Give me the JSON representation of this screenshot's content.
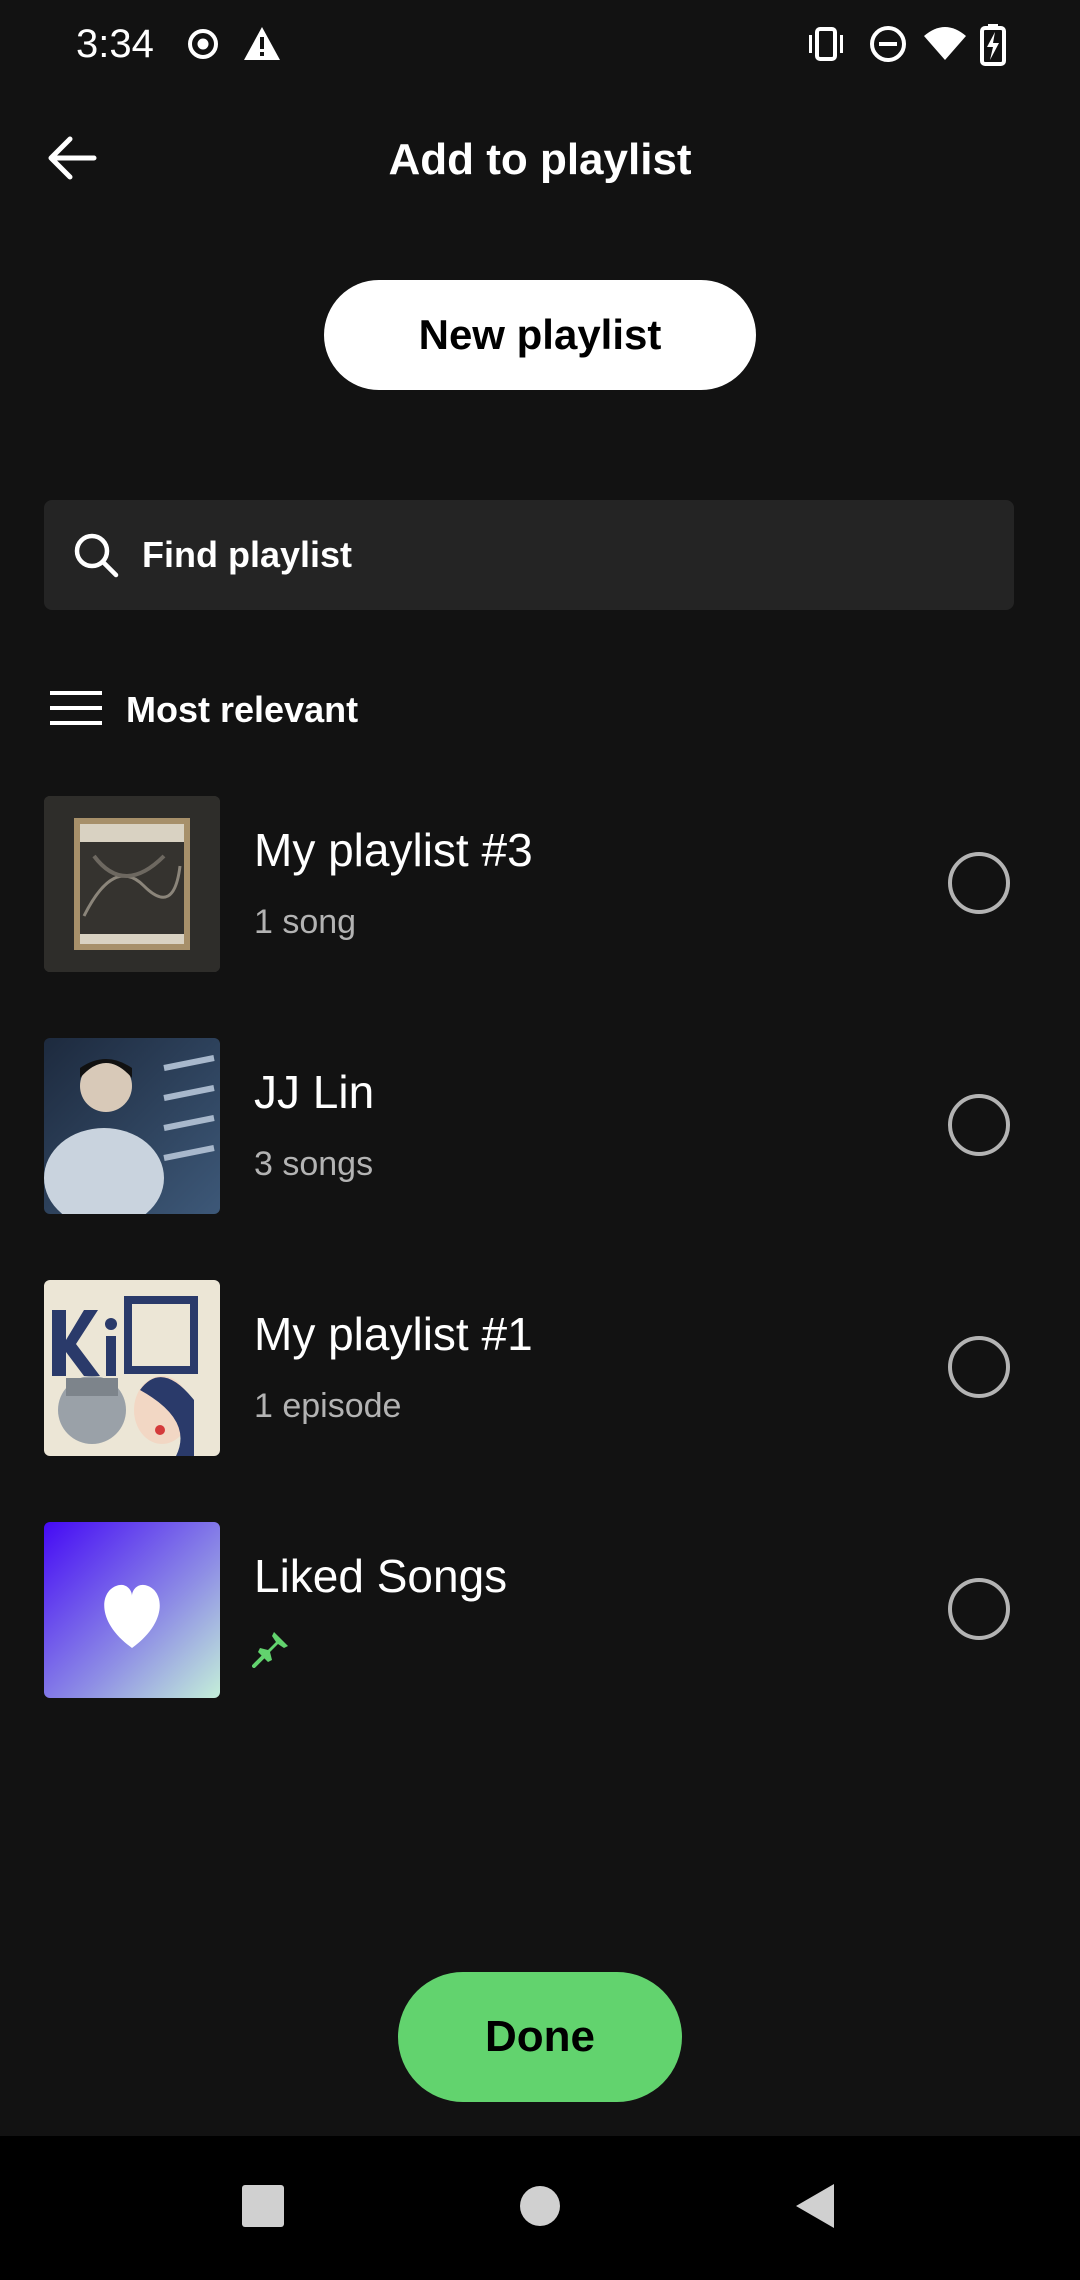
{
  "status_bar": {
    "time": "3:34",
    "left_icons": [
      "record-icon",
      "warning-icon"
    ],
    "right_icons": [
      "vibrate-icon",
      "do-not-disturb-icon",
      "wifi-icon",
      "battery-charging-icon"
    ]
  },
  "header": {
    "title": "Add to playlist",
    "back_icon": "arrow-left-icon"
  },
  "new_playlist": {
    "label": "New playlist"
  },
  "search": {
    "placeholder": "Find playlist",
    "icon": "search-icon"
  },
  "sort": {
    "label": "Most relevant",
    "icon": "sort-list-icon"
  },
  "playlists": [
    {
      "title": "My playlist #3",
      "subtitle": "1 song",
      "selected": false
    },
    {
      "title": "JJ Lin",
      "subtitle": "3 songs",
      "selected": false
    },
    {
      "title": "My playlist #1",
      "subtitle": "1 episode",
      "selected": false
    },
    {
      "title": "Liked Songs",
      "subtitle": "",
      "pinned": true,
      "selected": false
    }
  ],
  "done": {
    "label": "Done"
  },
  "nav_bar": {
    "icons": [
      "recents-square-icon",
      "home-circle-icon",
      "back-triangle-icon"
    ]
  },
  "colors": {
    "background": "#121212",
    "accent_green": "#62d36e",
    "search_bg": "#242424",
    "secondary_text": "#b3b3b3",
    "liked_gradient_start": "#450af5",
    "liked_gradient_end": "#c4efd9"
  }
}
